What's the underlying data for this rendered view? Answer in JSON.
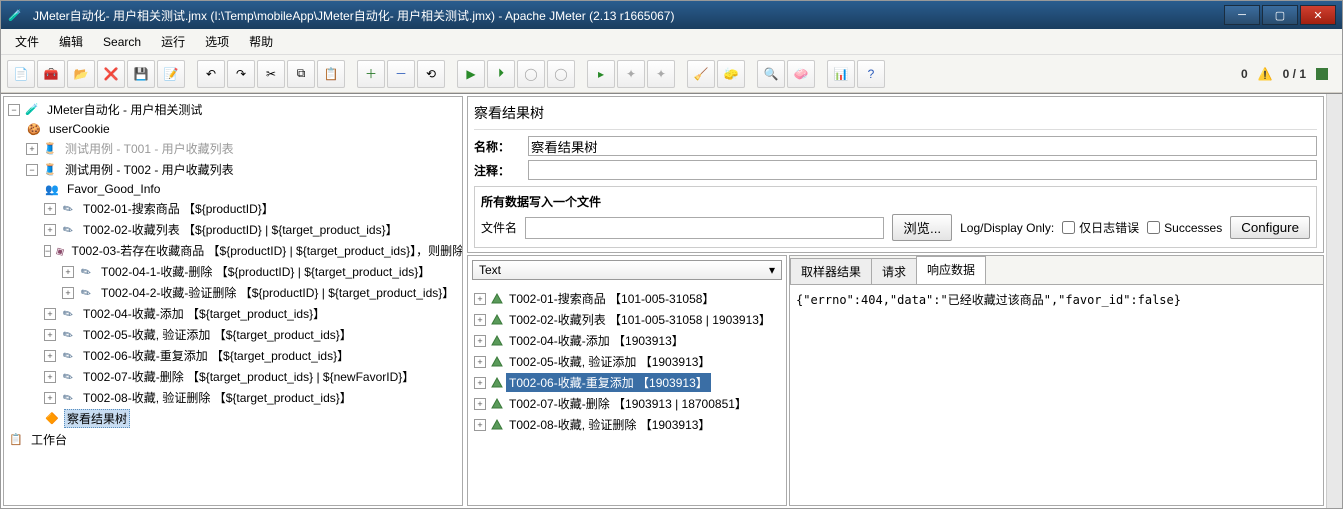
{
  "titlebar": {
    "text": "JMeter自动化- 用户相关测试.jmx (I:\\Temp\\mobileApp\\JMeter自动化- 用户相关测试.jmx) - Apache JMeter (2.13 r1665067)"
  },
  "menu": [
    "文件",
    "编辑",
    "Search",
    "运行",
    "选项",
    "帮助"
  ],
  "status": {
    "left_counter": "0",
    "right_counter": "0 / 1"
  },
  "tree": {
    "root": "JMeter自动化 - 用户相关测试",
    "cookie": "userCookie",
    "t001": "测试用例 - T001 - 用户收藏列表",
    "t002": "测试用例 - T002 - 用户收藏列表",
    "favor": "Favor_Good_Info",
    "items": [
      "T002-01-搜索商品 【${productID}】",
      "T002-02-收藏列表 【${productID} | ${target_product_ids}】",
      "T002-03-若存在收藏商品 【${productID} | ${target_product_ids}】，则删除",
      "T002-04-收藏-添加 【${target_product_ids}】",
      "T002-05-收藏, 验证添加 【${target_product_ids}】",
      "T002-06-收藏-重复添加 【${target_product_ids}】",
      "T002-07-收藏-删除 【${target_product_ids} | ${newFavorID}】",
      "T002-08-收藏, 验证删除 【${target_product_ids}】"
    ],
    "subitems": [
      "T002-04-1-收藏-删除 【${productID} | ${target_product_ids}】",
      "T002-04-2-收藏-验证删除 【${productID} | ${target_product_ids}】"
    ],
    "results_tree": "察看结果树",
    "workbench": "工作台"
  },
  "panel": {
    "title": "察看结果树",
    "name_label": "名称：",
    "name_value": "察看结果树",
    "comment_label": "注释：",
    "comment_value": "",
    "write_group": "所有数据写入一个文件",
    "filename_label": "文件名",
    "filename_value": "",
    "browse": "浏览...",
    "log_display": "Log/Display Only:",
    "errors_only": "仅日志错误",
    "successes": "Successes",
    "configure": "Configure"
  },
  "result_combo": "Text",
  "results": [
    "T002-01-搜索商品 【101-005-31058】",
    "T002-02-收藏列表 【101-005-31058 | 1903913】",
    "T002-04-收藏-添加 【1903913】",
    "T002-05-收藏, 验证添加 【1903913】",
    "T002-06-收藏-重复添加 【1903913】",
    "T002-07-收藏-删除 【1903913 | 18700851】",
    "T002-08-收藏, 验证删除 【1903913】"
  ],
  "result_selected_index": 4,
  "tabs": [
    "取样器结果",
    "请求",
    "响应数据"
  ],
  "active_tab": 2,
  "response_body": "{\"errno\":404,\"data\":\"已经收藏过该商品\",\"favor_id\":false}"
}
